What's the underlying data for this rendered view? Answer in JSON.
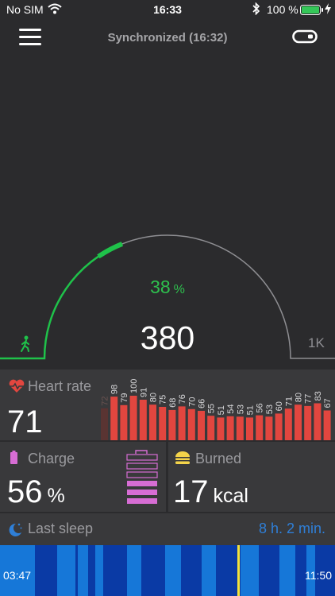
{
  "status_bar": {
    "carrier": "No SIM",
    "time": "16:33",
    "battery_percent": "100 %",
    "icons": [
      "wifi-icon",
      "bluetooth-icon",
      "battery-icon",
      "charging-bolt-icon"
    ]
  },
  "nav": {
    "title": "Synchronized (16:32)",
    "icons": [
      "hamburger-menu-icon",
      "fitness-band-icon"
    ]
  },
  "steps": {
    "percent": "38",
    "percent_unit": "%",
    "progress_fraction": 0.38,
    "count": "380",
    "goal": "1K",
    "icon": "walking-person-icon",
    "colors": {
      "progress": "#1fc24a",
      "track": "#8e8e92"
    }
  },
  "heart_rate": {
    "label": "Heart rate",
    "value": "71",
    "icon": "heart-pulse-icon",
    "color": "#e2463f",
    "series": [
      "72",
      "98",
      "79",
      "100",
      "91",
      "80",
      "75",
      "68",
      "76",
      "70",
      "66",
      "55",
      "51",
      "54",
      "53",
      "51",
      "56",
      "53",
      "60",
      "71",
      "80",
      "77",
      "83",
      "67"
    ]
  },
  "charge": {
    "label": "Charge",
    "value": "56",
    "unit": "%",
    "icon": "battery-icon",
    "level_fraction": 0.56,
    "color": "#d76dd4"
  },
  "burned": {
    "label": "Burned",
    "value": "17",
    "unit": "kcal",
    "icon": "burger-icon",
    "color": "#f3d34a"
  },
  "sleep": {
    "label": "Last sleep",
    "duration": "8 h. 2 min.",
    "start": "03:47",
    "end": "11:50",
    "icon": "moon-stars-icon",
    "colors": {
      "light": "#1677d8",
      "deep": "#0a3aa5",
      "marker": "#f5e33a"
    }
  }
}
